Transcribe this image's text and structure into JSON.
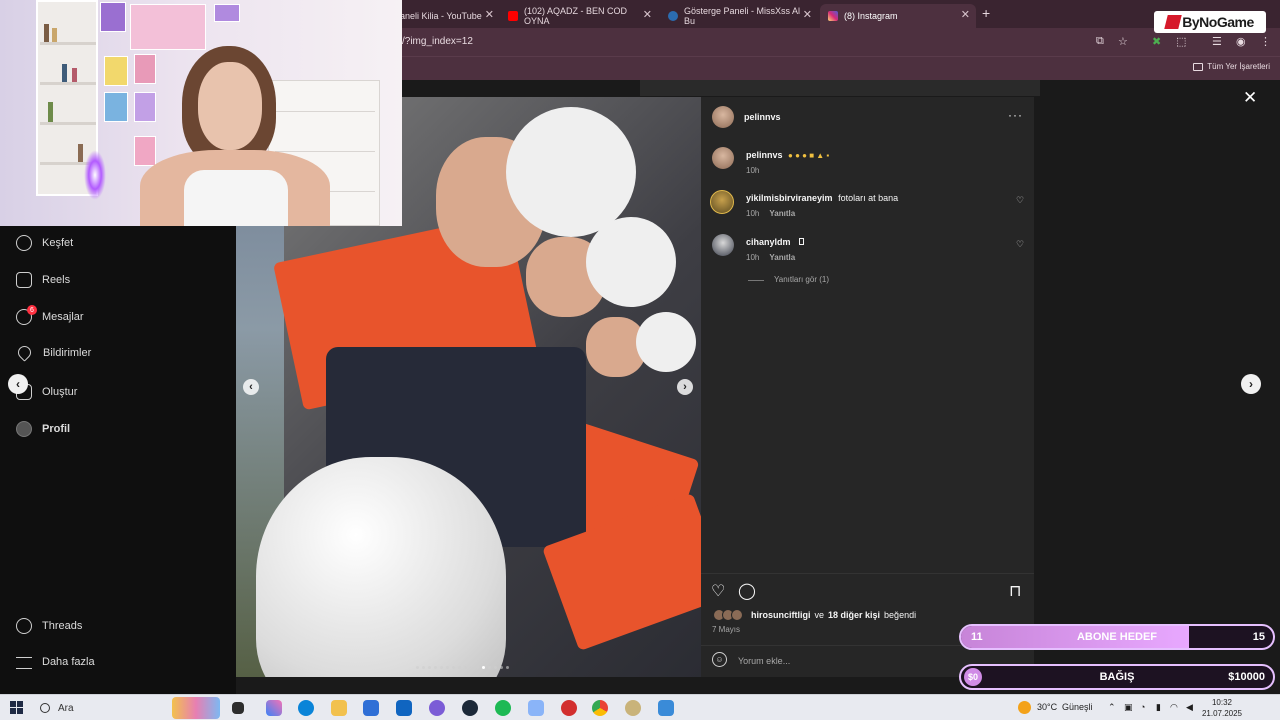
{
  "browser": {
    "tabs": [
      {
        "title": "aneli Kilia - YouTube",
        "favicon_color": "#ff0000"
      },
      {
        "title": "(102) AQADZ - BEN COD OYNA",
        "favicon_color": "#ff0000"
      },
      {
        "title": "Gösterge Paneli - MissXss Al Bu",
        "favicon_color": "#2b6cb0"
      },
      {
        "title": "(8) Instagram",
        "favicon_color": "#d62976"
      }
    ],
    "new_tab_icon": "plus-icon",
    "url": "/?img_index=12",
    "bookmarks_label": "Tüm Yer İşaretleri"
  },
  "brand": {
    "text": "ByNoGame"
  },
  "sidebar": {
    "items": [
      {
        "label": "Keşfet",
        "icon": "compass-icon"
      },
      {
        "label": "Reels",
        "icon": "reels-icon"
      },
      {
        "label": "Mesajlar",
        "icon": "messenger-icon",
        "badge": "6"
      },
      {
        "label": "Bildirimler",
        "icon": "heart-icon"
      },
      {
        "label": "Oluştur",
        "icon": "plus-square-icon"
      },
      {
        "label": "Profil",
        "icon": "profile-avatar"
      }
    ],
    "bottom_items": [
      {
        "label": "Threads",
        "icon": "threads-icon"
      },
      {
        "label": "Daha fazla",
        "icon": "menu-icon"
      }
    ]
  },
  "post": {
    "author": "pelinnvs",
    "caption_user": "pelinnvs",
    "caption_time": "10h",
    "comments": [
      {
        "user": "yikilmisbirviraneyim",
        "text": "fotoları at bana",
        "time": "10h",
        "reply": "Yanıtla"
      },
      {
        "user": "cihanyldm",
        "text": "",
        "time": "10h",
        "reply": "Yanıtla"
      }
    ],
    "view_replies": "Yanıtları gör (1)",
    "likes_user": "hirosunciftligi",
    "likes_connector": "ve",
    "likes_others": "18 diğer kişi",
    "likes_suffix": "beğendi",
    "date": "7 Mayıs",
    "comment_placeholder": "Yorum ekle...",
    "carousel_total": 16,
    "carousel_active": 12
  },
  "widgets": {
    "sub_goal": {
      "left": "11",
      "label": "ABONE HEDEF",
      "right": "15",
      "progress": 0.73
    },
    "donation": {
      "left": "$0",
      "label": "BAĞIŞ",
      "right": "$10000",
      "progress": 0.0
    }
  },
  "taskbar": {
    "search_label": "Ara",
    "weather": "30°C",
    "weather_desc": "Güneşli",
    "time": "10:32",
    "date": "21.07.2025"
  },
  "colors": {
    "instagram_bg": "#121212",
    "panel_bg": "#262626",
    "browser_chrome": "#4d303f",
    "widget_accent": "#e8a8ff"
  }
}
